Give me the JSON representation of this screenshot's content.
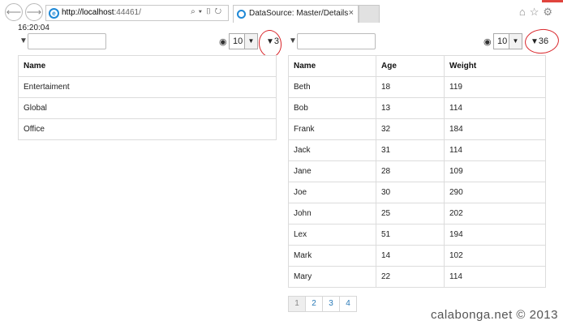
{
  "browser": {
    "url_host": "http://localhost",
    "url_rest": ":44461/",
    "tab_title": "DataSource: Master/Details",
    "tab_close": "×"
  },
  "time": "16:20:04",
  "master": {
    "page_size": "10",
    "filter_count": "3",
    "header": "Name",
    "rows": [
      "Entertaiment",
      "Global",
      "Office"
    ]
  },
  "details": {
    "page_size": "10",
    "filter_count": "36",
    "headers": [
      "Name",
      "Age",
      "Weight"
    ],
    "rows": [
      [
        "Beth",
        "18",
        "119"
      ],
      [
        "Bob",
        "13",
        "114"
      ],
      [
        "Frank",
        "32",
        "184"
      ],
      [
        "Jack",
        "31",
        "114"
      ],
      [
        "Jane",
        "28",
        "109"
      ],
      [
        "Joe",
        "30",
        "290"
      ],
      [
        "John",
        "25",
        "202"
      ],
      [
        "Lex",
        "51",
        "194"
      ],
      [
        "Mark",
        "14",
        "102"
      ],
      [
        "Mary",
        "22",
        "114"
      ]
    ],
    "pages": [
      "1",
      "2",
      "3",
      "4"
    ],
    "active_page": "1"
  },
  "watermark": "calabonga.net © 2013",
  "icons": [
    "back-icon",
    "forward-icon",
    "ie-icon",
    "search-icon",
    "compat-icon",
    "refresh-icon",
    "home-icon",
    "star-icon",
    "gear-icon",
    "filter-icon",
    "eye-icon"
  ]
}
